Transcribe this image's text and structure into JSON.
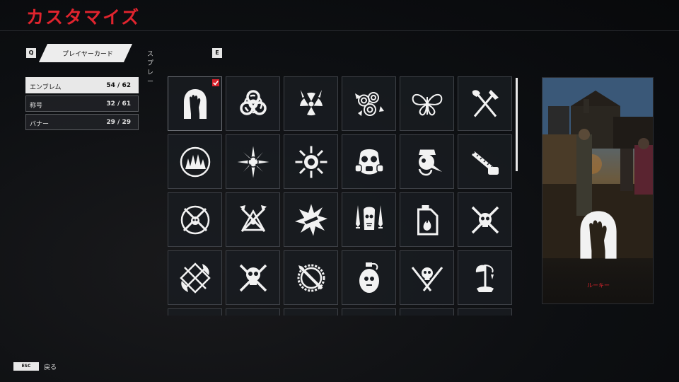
{
  "header": {
    "title": "カスタマイズ"
  },
  "tabs": {
    "prev_key": "Q",
    "next_key": "E",
    "items": [
      {
        "label": "プレイヤーカード",
        "active": true
      },
      {
        "label": "スプレー",
        "active": false
      }
    ]
  },
  "menu": {
    "items": [
      {
        "label": "エンブレム",
        "count": "54 / 62",
        "active": true
      },
      {
        "label": "称号",
        "count": "32 / 61",
        "active": false
      },
      {
        "label": "バナー",
        "count": "29 / 29",
        "active": false
      }
    ]
  },
  "grid": {
    "rows": 5,
    "cols": 6,
    "selected_index": 0,
    "emblems": [
      "zombie-hand-icon",
      "biohazard-icon",
      "radiation-icon",
      "roses-icon",
      "butterfly-icon",
      "axe-shovel-icon",
      "forest-icon",
      "compass-star-icon",
      "spiked-sun-icon",
      "gas-mask-icon",
      "plague-doctor-icon",
      "chainsaw-icon",
      "skull-pickaxe-icon",
      "crossed-axes-icon",
      "explosion-icon",
      "dagger-skull-icon",
      "fuel-can-icon",
      "skull-chainsaws-icon",
      "scythes-icon",
      "skull-crossed-blades-icon",
      "buzzsaw-blade-icon",
      "grenade-icon",
      "skull-rifles-icon",
      "axe-stump-icon"
    ]
  },
  "preview": {
    "emblem": "zombie-hand-icon",
    "caption": "ルーキー"
  },
  "footer": {
    "esc_key": "ESC",
    "back_label": "戻る"
  }
}
